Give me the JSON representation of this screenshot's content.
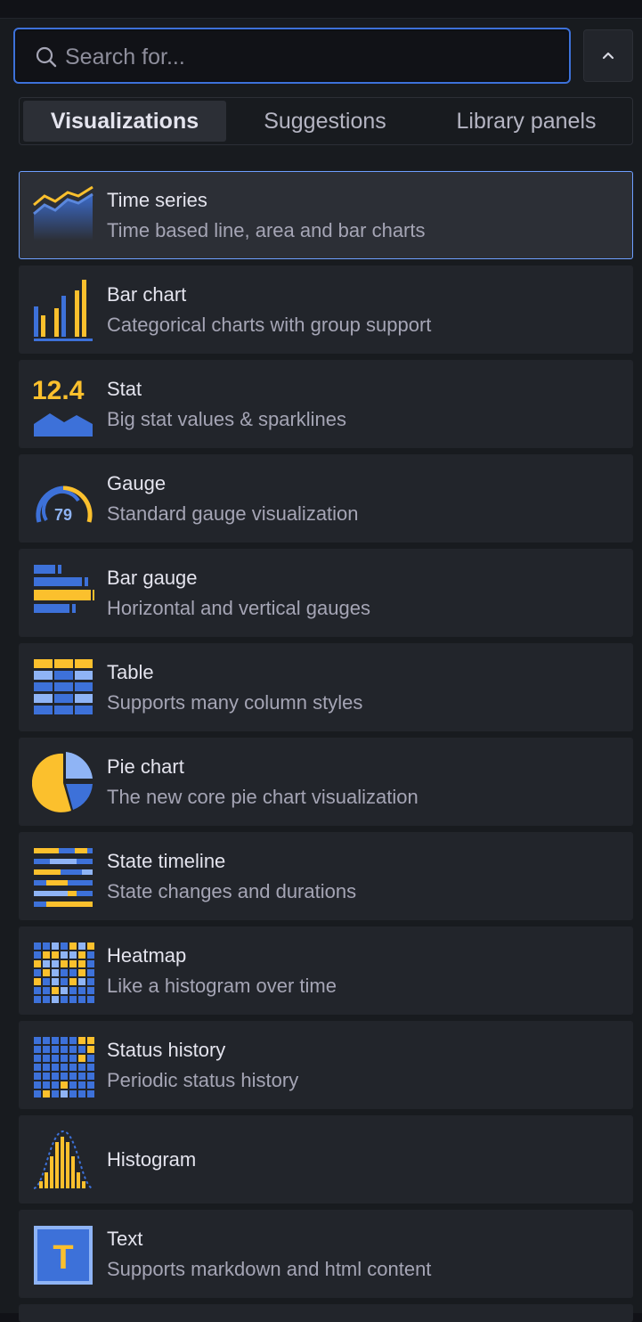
{
  "search": {
    "placeholder": "Search for..."
  },
  "tabs": [
    {
      "label": "Visualizations",
      "active": true
    },
    {
      "label": "Suggestions",
      "active": false
    },
    {
      "label": "Library panels",
      "active": false
    }
  ],
  "colors": {
    "accent_blue": "#3d71d9",
    "icon_blue": "#5a87dd",
    "icon_yellow": "#fbc02d",
    "selected_border": "#6e9fff"
  },
  "visualizations": [
    {
      "title": "Time series",
      "description": "Time based line, area and bar charts",
      "icon": "time-series-icon",
      "selected": true
    },
    {
      "title": "Bar chart",
      "description": "Categorical charts with group support",
      "icon": "bar-chart-icon"
    },
    {
      "title": "Stat",
      "description": "Big stat values & sparklines",
      "icon": "stat-icon",
      "icon_value": "12.4"
    },
    {
      "title": "Gauge",
      "description": "Standard gauge visualization",
      "icon": "gauge-icon",
      "icon_value": "79"
    },
    {
      "title": "Bar gauge",
      "description": "Horizontal and vertical gauges",
      "icon": "bar-gauge-icon"
    },
    {
      "title": "Table",
      "description": "Supports many column styles",
      "icon": "table-icon"
    },
    {
      "title": "Pie chart",
      "description": "The new core pie chart visualization",
      "icon": "pie-chart-icon"
    },
    {
      "title": "State timeline",
      "description": "State changes and durations",
      "icon": "state-timeline-icon"
    },
    {
      "title": "Heatmap",
      "description": "Like a histogram over time",
      "icon": "heatmap-icon"
    },
    {
      "title": "Status history",
      "description": "Periodic status history",
      "icon": "status-history-icon"
    },
    {
      "title": "Histogram",
      "description": "",
      "icon": "histogram-icon"
    },
    {
      "title": "Text",
      "description": "Supports markdown and html content",
      "icon": "text-icon",
      "icon_glyph": "T"
    }
  ]
}
